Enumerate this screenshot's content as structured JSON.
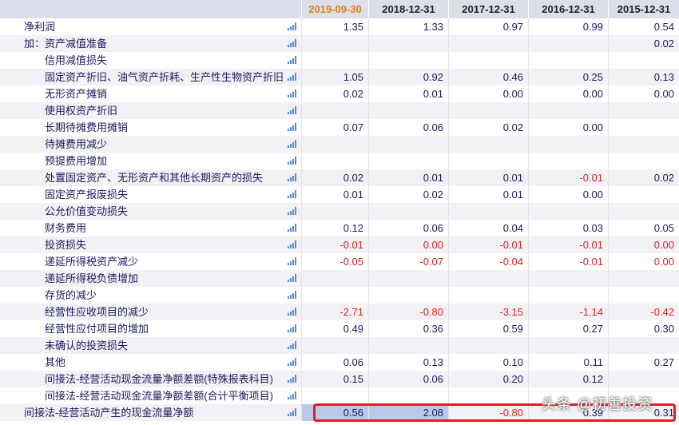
{
  "columns": [
    "2019-09-30",
    "2018-12-31",
    "2017-12-31",
    "2016-12-31",
    "2015-12-31"
  ],
  "active_column": 0,
  "rows": [
    {
      "label": "净利润",
      "indent": false,
      "values": [
        "1.35",
        "1.33",
        "0.97",
        "0.99",
        "0.54"
      ]
    },
    {
      "label": "加：资产减值准备",
      "indent": false,
      "values": [
        "",
        "",
        "",
        "",
        "0.02"
      ]
    },
    {
      "label": "信用减值损失",
      "indent": true,
      "values": [
        "",
        "",
        "",
        "",
        ""
      ]
    },
    {
      "label": "固定资产折旧、油气资产折耗、生产性生物资产折旧",
      "indent": true,
      "values": [
        "1.05",
        "0.92",
        "0.46",
        "0.25",
        "0.13"
      ]
    },
    {
      "label": "无形资产摊销",
      "indent": true,
      "values": [
        "0.02",
        "0.01",
        "0.00",
        "0.00",
        "0.00"
      ]
    },
    {
      "label": "使用权资产折旧",
      "indent": true,
      "values": [
        "",
        "",
        "",
        "",
        ""
      ]
    },
    {
      "label": "长期待摊费用摊销",
      "indent": true,
      "values": [
        "0.07",
        "0.06",
        "0.02",
        "0.00",
        ""
      ]
    },
    {
      "label": "待摊费用减少",
      "indent": true,
      "values": [
        "",
        "",
        "",
        "",
        ""
      ]
    },
    {
      "label": "预提费用增加",
      "indent": true,
      "values": [
        "",
        "",
        "",
        "",
        ""
      ]
    },
    {
      "label": "处置固定资产、无形资产和其他长期资产的损失",
      "indent": true,
      "values": [
        "0.02",
        "0.01",
        "0.01",
        "-0.01",
        "0.02"
      ]
    },
    {
      "label": "固定资产报废损失",
      "indent": true,
      "values": [
        "0.01",
        "0.02",
        "0.01",
        "0.00",
        ""
      ]
    },
    {
      "label": "公允价值变动损失",
      "indent": true,
      "values": [
        "",
        "",
        "",
        "",
        ""
      ]
    },
    {
      "label": "财务费用",
      "indent": true,
      "values": [
        "0.12",
        "0.06",
        "0.04",
        "0.03",
        "0.05"
      ]
    },
    {
      "label": "投资损失",
      "indent": true,
      "values": [
        "-0.01",
        "0.00",
        "-0.01",
        "-0.01",
        "0.00"
      ],
      "red": [
        true,
        true,
        true,
        true,
        true
      ]
    },
    {
      "label": "递延所得税资产减少",
      "indent": true,
      "values": [
        "-0.05",
        "-0.07",
        "-0.04",
        "-0.01",
        "0.00"
      ],
      "red": [
        true,
        true,
        true,
        true,
        true
      ]
    },
    {
      "label": "递延所得税负债增加",
      "indent": true,
      "values": [
        "",
        "",
        "",
        "",
        ""
      ]
    },
    {
      "label": "存货的减少",
      "indent": true,
      "values": [
        "",
        "",
        "",
        "",
        ""
      ]
    },
    {
      "label": "经营性应收项目的减少",
      "indent": true,
      "values": [
        "-2.71",
        "-0.80",
        "-3.15",
        "-1.14",
        "-0.42"
      ]
    },
    {
      "label": "经营性应付项目的增加",
      "indent": true,
      "values": [
        "0.49",
        "0.36",
        "0.59",
        "0.27",
        "0.30"
      ]
    },
    {
      "label": "未确认的投资损失",
      "indent": true,
      "values": [
        "",
        "",
        "",
        "",
        ""
      ]
    },
    {
      "label": "其他",
      "indent": true,
      "values": [
        "0.06",
        "0.13",
        "0.10",
        "0.11",
        "0.27"
      ]
    },
    {
      "label": "间接法-经营活动现金流量净额差额(特殊报表科目)",
      "indent": true,
      "values": [
        "0.15",
        "0.06",
        "0.20",
        "0.12",
        ""
      ]
    },
    {
      "label": "间接法-经营活动现金流量净额差额(合计平衡项目)",
      "indent": true,
      "values": [
        "",
        "",
        "",
        "",
        ""
      ]
    },
    {
      "label": "间接法-经营活动产生的现金流量净额",
      "indent": false,
      "values": [
        "0.56",
        "2.08",
        "-0.80",
        "0.39",
        "0.31"
      ],
      "selected": true
    }
  ],
  "watermark": "头条 @初善投资",
  "colors": {
    "negative": "#e02020",
    "text": "#1a1a5e",
    "active_header": "#e07b16",
    "highlight": "#e02020"
  }
}
